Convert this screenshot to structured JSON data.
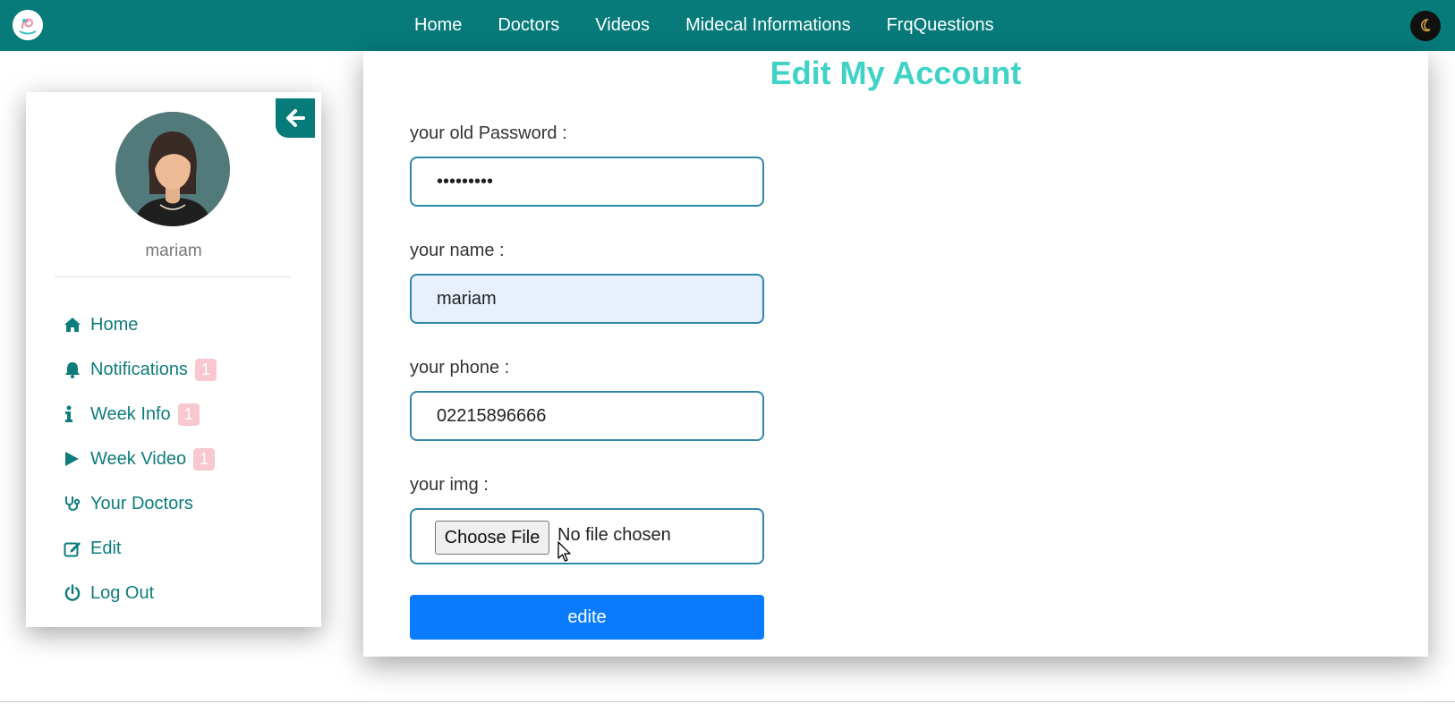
{
  "navbar": {
    "links": [
      "Home",
      "Doctors",
      "Videos",
      "Midecal Informations",
      "FrqQuestions"
    ]
  },
  "sidebar": {
    "username": "mariam",
    "items": [
      {
        "label": "Home",
        "icon": "home-icon"
      },
      {
        "label": "Notifications",
        "icon": "bell-icon",
        "badge": "1"
      },
      {
        "label": "Week Info",
        "icon": "info-icon",
        "badge": "1"
      },
      {
        "label": "Week Video",
        "icon": "play-icon",
        "badge": "1"
      },
      {
        "label": "Your Doctors",
        "icon": "stethoscope-icon"
      },
      {
        "label": "Edit",
        "icon": "edit-icon"
      },
      {
        "label": "Log Out",
        "icon": "power-icon"
      }
    ]
  },
  "form": {
    "title": "Edit My Account",
    "old_password": {
      "label": "your old Password :",
      "value": "*********"
    },
    "name": {
      "label": "your name :",
      "value": "mariam"
    },
    "phone": {
      "label": "your phone :",
      "value": "02215896666"
    },
    "img": {
      "label": "your img :",
      "button": "Choose File",
      "status": "No file chosen"
    },
    "submit": "edite"
  },
  "colors": {
    "navbar": "#067b7a",
    "sidebar_text": "#0d7c7b",
    "title": "#3fd2c6",
    "badge": "#f9c7cf",
    "input_border": "#2e88a8",
    "submit": "#0a7bff"
  }
}
